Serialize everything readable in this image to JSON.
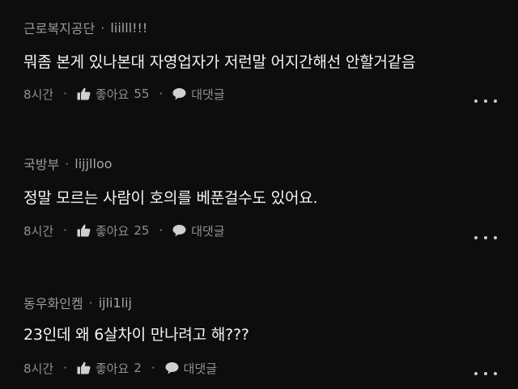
{
  "comments": [
    {
      "affiliation": "근로복지공단",
      "separator": "·",
      "nickname": "liilll!!!",
      "text": "뭐좀 본게 있나본대 자영업자가 저런말 어지간해선 안할거같음",
      "time": "8시간",
      "dot": "·",
      "like_label": "좋아요",
      "like_count": "55",
      "reply_label": "대댓글"
    },
    {
      "affiliation": "국방부",
      "separator": "·",
      "nickname": "lijjlloo",
      "text": "정말 모르는 사람이 호의를 베푼걸수도 있어요.",
      "time": "8시간",
      "dot": "·",
      "like_label": "좋아요",
      "like_count": "25",
      "reply_label": "대댓글"
    },
    {
      "affiliation": "동우화인켐",
      "separator": "·",
      "nickname": "ijli1lij",
      "text": "23인데 왜 6살차이 만나려고 해???",
      "time": "8시간",
      "dot": "·",
      "like_label": "좋아요",
      "like_count": "2",
      "reply_label": "대댓글"
    }
  ],
  "icons": {
    "like": "thumbs-up-icon",
    "reply": "speech-bubble-icon",
    "more": "more-horizontal-icon"
  },
  "colors": {
    "background": "#0d0d0d",
    "text": "#f4f4f4",
    "muted": "#9a9a9a",
    "icon": "#cfcfcf"
  }
}
